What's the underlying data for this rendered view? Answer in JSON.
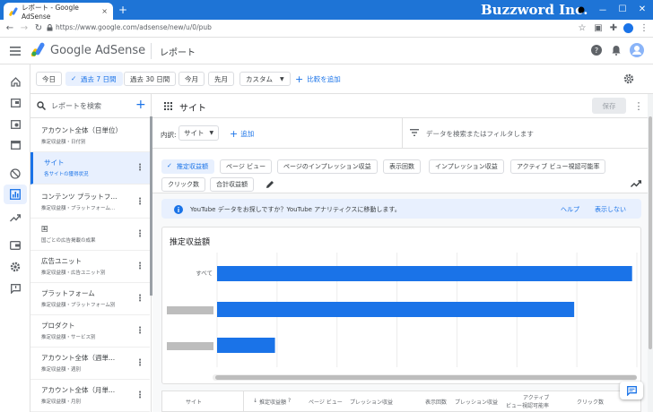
{
  "browser": {
    "tab_title": "レポート - Google AdSense",
    "tab_close": "×",
    "new_tab": "+",
    "brand": "Buzzword Inc.",
    "url": "https://www.google.com/adsense/new/u/0/pub",
    "window": {
      "minimize": "－",
      "maximize": "☐",
      "close": "✕"
    }
  },
  "app": {
    "product": "Google AdSense",
    "page_title": "レポート"
  },
  "date_filters": [
    {
      "label": "今日",
      "selected": false
    },
    {
      "label": "過去 7 日間",
      "selected": true
    },
    {
      "label": "過去 30 日間",
      "selected": false
    },
    {
      "label": "今月",
      "selected": false
    },
    {
      "label": "先月",
      "selected": false
    },
    {
      "label": "カスタム",
      "selected": false
    }
  ],
  "compare_label": "比較を追加",
  "reports": {
    "search_placeholder": "レポートを検索",
    "items": [
      {
        "title": "アカウント全体（日単位）",
        "sub": "推定収益額・日付別"
      },
      {
        "title": "サイト",
        "sub": "各サイトの獲得状況"
      },
      {
        "title": "コンテンツ プラットフ...",
        "sub": "推定収益額・プラットフォーム..."
      },
      {
        "title": "国",
        "sub": "国ごとの広告掲載の成果"
      },
      {
        "title": "広告ユニット",
        "sub": "推定収益額・広告ユニット別"
      },
      {
        "title": "プラットフォーム",
        "sub": "推定収益額・プラットフォーム別"
      },
      {
        "title": "プロダクト",
        "sub": "推定収益額・サービス別"
      },
      {
        "title": "アカウント全体（週単...",
        "sub": "推定収益額・週別"
      },
      {
        "title": "アカウント全体（月単...",
        "sub": "推定収益額・月別"
      }
    ]
  },
  "report": {
    "title": "サイト",
    "save_label": "保存",
    "breakdown_label": "内訳:",
    "breakdown_value": "サイト",
    "add_label": "追加",
    "filter_placeholder": "データを検索またはフィルタします",
    "metrics": [
      {
        "label": "推定収益額",
        "selected": true
      },
      {
        "label": "ページ ビュー",
        "selected": false
      },
      {
        "label": "ページのインプレッション収益",
        "selected": false
      },
      {
        "label": "表示回数",
        "selected": false
      },
      {
        "label": "インプレッション収益",
        "selected": false
      },
      {
        "label": "アクティブ ビュー視認可能率",
        "selected": false
      },
      {
        "label": "クリック数",
        "selected": false
      },
      {
        "label": "合計収益額",
        "selected": false
      }
    ],
    "info_text": "YouTube データをお探しですか？YouTube アナリティクスに移動します。",
    "info_help": "ヘルプ",
    "info_dismiss": "表示しない",
    "chart_title": "推定収益額"
  },
  "chart_data": {
    "type": "bar",
    "orientation": "horizontal",
    "categories": [
      "すべて",
      "",
      ""
    ],
    "values": [
      0.86,
      0.74,
      0.12
    ],
    "title": "推定収益額",
    "xlabel": "",
    "ylabel": "",
    "grid": true,
    "bar_color": "#1a73e8",
    "redacted_label_color": "#bdbdbd"
  },
  "table": {
    "headers": [
      "サイト",
      "推定収益額",
      "ページ ビュー",
      "プレッション収益",
      "表示回数",
      "プレッション収益",
      "アクティブ",
      "クリック数"
    ],
    "sub_headers": [
      "",
      "",
      "",
      "",
      "",
      "",
      "ビュー視認可能率",
      ""
    ]
  },
  "colors": {
    "accent": "#1a73e8",
    "chrome": "#1e74d6"
  }
}
